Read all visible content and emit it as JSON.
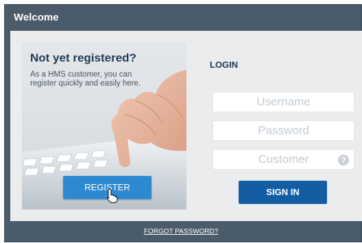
{
  "window": {
    "title": "Welcome"
  },
  "promo": {
    "title": "Not yet registered?",
    "text": "As a HMS customer, you can register quickly and easily here.",
    "register_label": "REGISTER"
  },
  "login": {
    "heading": "LOGIN",
    "username_placeholder": "Username",
    "password_placeholder": "Password",
    "customer_placeholder": "Customer",
    "help_icon_glyph": "?",
    "signin_label": "SIGN IN"
  },
  "footer": {
    "forgot_label": "FORGOT PASSWORD?"
  },
  "colors": {
    "frame": "#4a5b6a",
    "panel": "#eaecee",
    "register_button": "#2d89d0",
    "signin_button": "#135ea3",
    "heading_text": "#1e3b56"
  },
  "icons": [
    "help-icon",
    "pointer-cursor-icon"
  ]
}
